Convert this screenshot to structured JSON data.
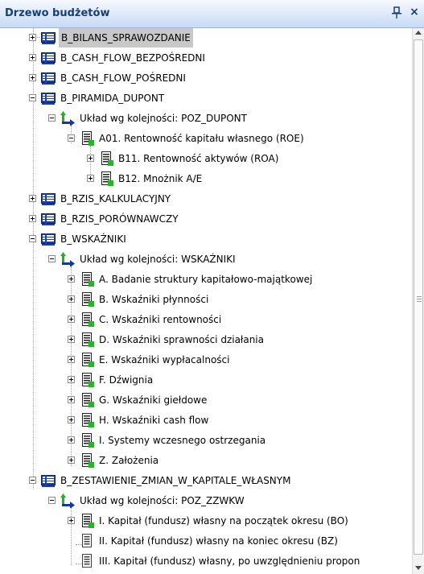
{
  "panel": {
    "title": "Drzewo budżetów",
    "pin_glyph": "ᵖ",
    "close_glyph": "×"
  },
  "icons": {
    "budget": "budget-icon",
    "order": "order-icon",
    "group": "group-icon",
    "item": "item-icon"
  },
  "colors": {
    "selection": "#c8c8c8",
    "title_text": "#153e7e",
    "accent_green": "#28b428",
    "accent_blue": "#1a3fa8"
  },
  "tree": {
    "items": [
      {
        "label": "B_BILANS_SPRAWOZDANIE"
      },
      {
        "label": "B_CASH_FLOW_BEZPOŚREDNI"
      },
      {
        "label": "B_CASH_FLOW_POŚREDNI"
      },
      {
        "label": "B_PIRAMIDA_DUPONT"
      },
      {
        "label": "Układ wg kolejności: POZ_DUPONT"
      },
      {
        "label": "A01. Rentowność kapitału własnego (ROE)"
      },
      {
        "label": "B11. Rentowność aktywów (ROA)"
      },
      {
        "label": "B12. Mnożnik A/E"
      },
      {
        "label": "B_RZIS_KALKULACYJNY"
      },
      {
        "label": "B_RZIS_PORÓWNAWCZY"
      },
      {
        "label": "B_WSKAŹNIKI"
      },
      {
        "label": "Układ wg kolejności: WSKAŹNIKI"
      },
      {
        "label": "A. Badanie struktury kapitałowo-majątkowej"
      },
      {
        "label": "B. Wskaźniki płynności"
      },
      {
        "label": "C. Wskaźniki rentowności"
      },
      {
        "label": "D. Wskaźniki sprawności działania"
      },
      {
        "label": "E. Wskaźniki wypłacalności"
      },
      {
        "label": "F. Dźwignia"
      },
      {
        "label": "G. Wskaźniki giełdowe"
      },
      {
        "label": "H. Wskaźniki cash flow"
      },
      {
        "label": "I. Systemy wczesnego ostrzegania"
      },
      {
        "label": "Z. Założenia"
      },
      {
        "label": "B_ZESTAWIENIE_ZMIAN_W_KAPITALE_WŁASNYM"
      },
      {
        "label": "Układ wg kolejności: POZ_ZZWKW"
      },
      {
        "label": "I. Kapitał (fundusz) własny na początek okresu (BO)"
      },
      {
        "label": "II. Kapitał (fundusz) własny na koniec okresu (BZ)"
      },
      {
        "label": "III. Kapitał (fundusz) własny, po uwzględnieniu propon"
      }
    ]
  }
}
